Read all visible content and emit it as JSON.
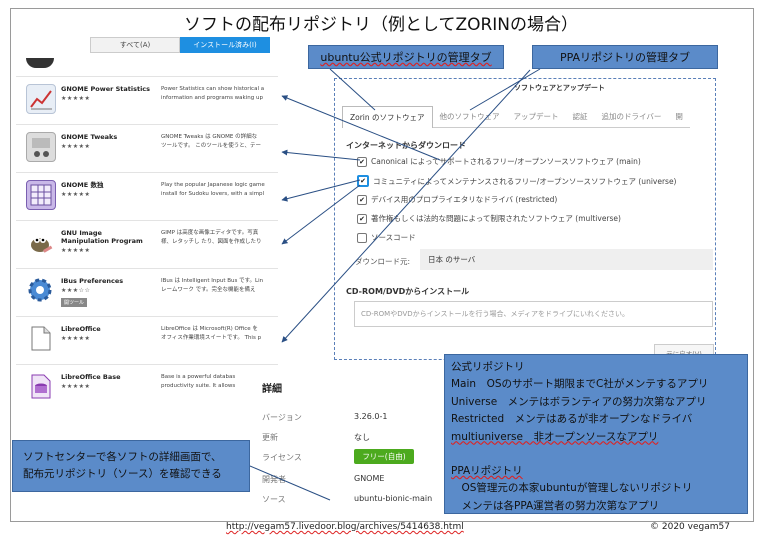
{
  "title": "ソフトの配布リポジトリ（例としてZORINの場合）",
  "software_center": {
    "tabs": [
      "すべて(A)",
      "インストール済み(I)"
    ],
    "apps": [
      {
        "name": "GNOME Power Statistics",
        "stars": "★★★★★",
        "desc1": "Power Statistics can show historical a",
        "desc2": "information and programs waking up"
      },
      {
        "name": "GNOME Tweaks",
        "stars": "★★★★★",
        "desc1": "GNOME Tweaks は GNOME の詳細な",
        "desc2": "ツールです。 このツールを使うと、テー"
      },
      {
        "name": "GNOME 数独",
        "stars": "★★★★★",
        "desc1": "Play the popular Japanese logic game",
        "desc2": "install for Sudoku lovers, with a simpl"
      },
      {
        "name": "GNU Image Manipulation Program",
        "stars": "★★★★★",
        "desc1": "GIMP は高度な画像エディタです。写真",
        "desc2": "様、レタッチし たり、図面を作成したり"
      },
      {
        "name": "IBus Preferences",
        "stars": "★★★☆☆",
        "badge": "開ツール",
        "desc1": "IBus は Intelligent Input Bus です。Lin",
        "desc2": "レームワーク です。完全な機能を備え"
      },
      {
        "name": "LibreOffice",
        "stars": "★★★★★",
        "desc1": "LibreOffice は Microsoft(R) Office を",
        "desc2": "オフィス作業環境スイートです。 This p"
      },
      {
        "name": "LibreOffice Base",
        "stars": "★★★★★",
        "desc1": "Base is a powerful databas",
        "desc2": "productivity suite. It allows"
      }
    ],
    "detail": {
      "heading": "詳細",
      "rows": [
        {
          "label": "バージョン",
          "value": "3.26.0-1"
        },
        {
          "label": "更新",
          "value": "なし"
        },
        {
          "label": "ライセンス",
          "value": "フリー(自由)"
        },
        {
          "label": "開発者",
          "value": "GNOME"
        },
        {
          "label": "ソース",
          "value": "ubuntu-bionic-main"
        }
      ]
    }
  },
  "dialog": {
    "title": "ソフトウェアとアップデート",
    "tabs": [
      "Zorin のソフトウェア",
      "他のソフトウェア",
      "アップデート",
      "認証",
      "追加のドライバー",
      "開"
    ],
    "section_internet": "インターネットからダウンロード",
    "checkboxes": [
      {
        "label": "Canonical によってサポートされるフリー/オープンソースソフトウェア (main)",
        "checked": true
      },
      {
        "label": "コミュニティによってメンテナンスされるフリー/オープンソースソフトウェア (universe)",
        "checked": true
      },
      {
        "label": "デバイス用のプロプライエタリなドライバ (restricted)",
        "checked": true
      },
      {
        "label": "著作権もしくは法的な問題によって制限されたソフトウェア (multiverse)",
        "checked": true
      },
      {
        "label": "ソースコード",
        "checked": false
      }
    ],
    "download_from_label": "ダウンロード元:",
    "download_from_value": "日本 のサーバ",
    "section_cdrom": "CD-ROM/DVDからインストール",
    "cdrom_placeholder": "CD-ROMやDVDからインストールを行う場合、メディアをドライブにいれください。",
    "revert_button": "元に戻す(V)",
    "checkmark": "✔"
  },
  "callouts": {
    "ubuntu_tab": "ubuntu公式リポジトリの管理タブ",
    "ppa_tab": "PPAリポジトリの管理タブ",
    "left_line1": "ソフトセンターで各ソフトの詳細画面で、",
    "left_line2": "配布元リポジトリ（ソース）を確認できる",
    "info_lines": [
      "公式リポジトリ",
      "Main　OSのサポート期限までC社がメンテするアプリ",
      "Universe　メンテはボランティアの努力次第なアプリ",
      "Restricted　メンテはあるが非オープンなドライバ",
      "multiuniverse　非オープンソースなアプリ",
      "",
      "PPAリポジトリ",
      "　OS管理元の本家ubuntuが管理しないリポジトリ",
      "　メンテは各PPA運営者の努力次第なアプリ"
    ]
  },
  "footer": {
    "url": "http://vegam57.livedoor.blog/archives/5414638.html",
    "copyright": "© 2020 vegam57"
  }
}
